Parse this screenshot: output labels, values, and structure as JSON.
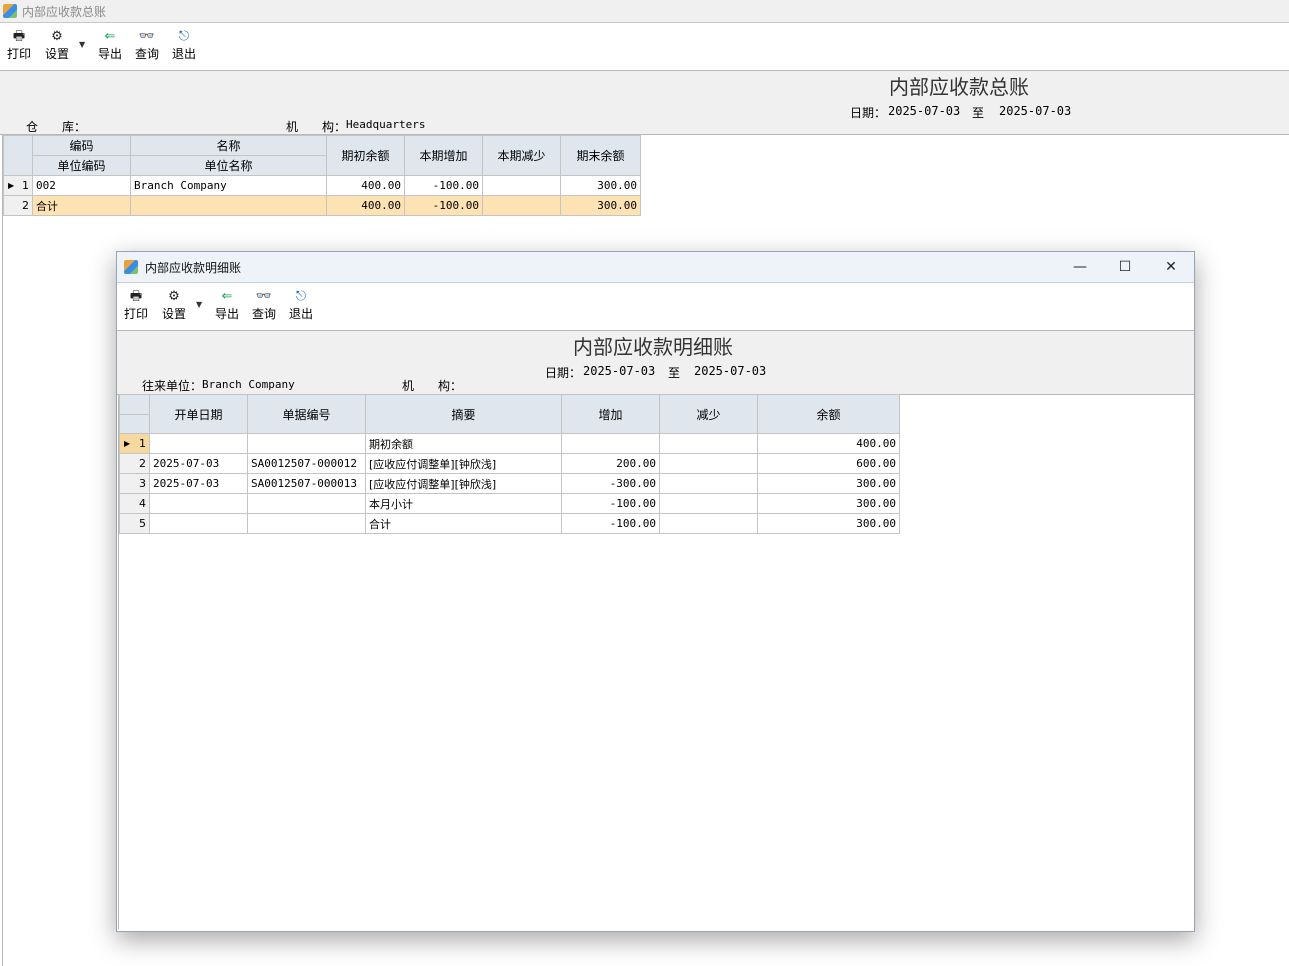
{
  "main": {
    "window_title": "内部应收款总账",
    "toolbar": [
      {
        "id": "print",
        "label": "打印",
        "icon": "printer-icon",
        "glyph": "🖶"
      },
      {
        "id": "settings",
        "label": "设置",
        "icon": "settings-icon",
        "glyph": "⚙"
      },
      {
        "id": "export",
        "label": "导出",
        "icon": "export-icon",
        "glyph": "⇐"
      },
      {
        "id": "query",
        "label": "查询",
        "icon": "binoculars-icon",
        "glyph": "👓"
      },
      {
        "id": "exit",
        "label": "退出",
        "icon": "exit-door-icon",
        "glyph": "⎋"
      }
    ],
    "dropdown_glyph": "▼",
    "report_title": "内部应收款总账",
    "date_label": "日期：",
    "date_from": "2025-07-03",
    "date_to_sep": "至",
    "date_to": "2025-07-03",
    "warehouse_label": "仓　　库：",
    "warehouse_value": "",
    "org_label": "机　　构：",
    "org_value": "Headquarters",
    "grid": {
      "header_top": {
        "code": "编码",
        "name": "名称"
      },
      "header_bottom": {
        "code": "单位编码",
        "name": "单位名称"
      },
      "headers": {
        "opening": "期初余额",
        "increase": "本期增加",
        "decrease": "本期减少",
        "closing": "期末余额"
      },
      "rows": [
        {
          "n": "1",
          "code": "002",
          "name": "Branch Company",
          "opening": "400.00",
          "increase": "-100.00",
          "decrease": "",
          "closing": "300.00"
        },
        {
          "n": "2",
          "code": "合计",
          "name": "",
          "opening": "400.00",
          "increase": "-100.00",
          "decrease": "",
          "closing": "300.00"
        }
      ]
    }
  },
  "detail": {
    "window_title": "内部应收款明细账",
    "window_controls": {
      "minimize": "—",
      "maximize": "☐",
      "close": "✕"
    },
    "report_title": "内部应收款明细账",
    "date_label": "日期：",
    "date_from": "2025-07-03",
    "date_to_sep": "至",
    "date_to": "2025-07-03",
    "partner_label": "往来单位：",
    "partner_value": "Branch Company",
    "org_label": "机　　构：",
    "org_value": "",
    "grid": {
      "headers": {
        "date": "开单日期",
        "doc": "单据编号",
        "summary": "摘要",
        "increase": "增加",
        "decrease": "减少",
        "balance": "余额"
      },
      "rows": [
        {
          "n": "1",
          "date": "",
          "doc": "",
          "summary": "期初余额",
          "increase": "",
          "decrease": "",
          "balance": "400.00"
        },
        {
          "n": "2",
          "date": "2025-07-03",
          "doc": "SA0012507-000012",
          "summary": "[应收应付调整单][钟欣浅]",
          "increase": "200.00",
          "decrease": "",
          "balance": "600.00"
        },
        {
          "n": "3",
          "date": "2025-07-03",
          "doc": "SA0012507-000013",
          "summary": "[应收应付调整单][钟欣浅]",
          "increase": "-300.00",
          "decrease": "",
          "balance": "300.00"
        },
        {
          "n": "4",
          "date": "",
          "doc": "",
          "summary": "本月小计",
          "increase": "-100.00",
          "decrease": "",
          "balance": "300.00"
        },
        {
          "n": "5",
          "date": "",
          "doc": "",
          "summary": "合计",
          "increase": "-100.00",
          "decrease": "",
          "balance": "300.00"
        }
      ]
    }
  }
}
